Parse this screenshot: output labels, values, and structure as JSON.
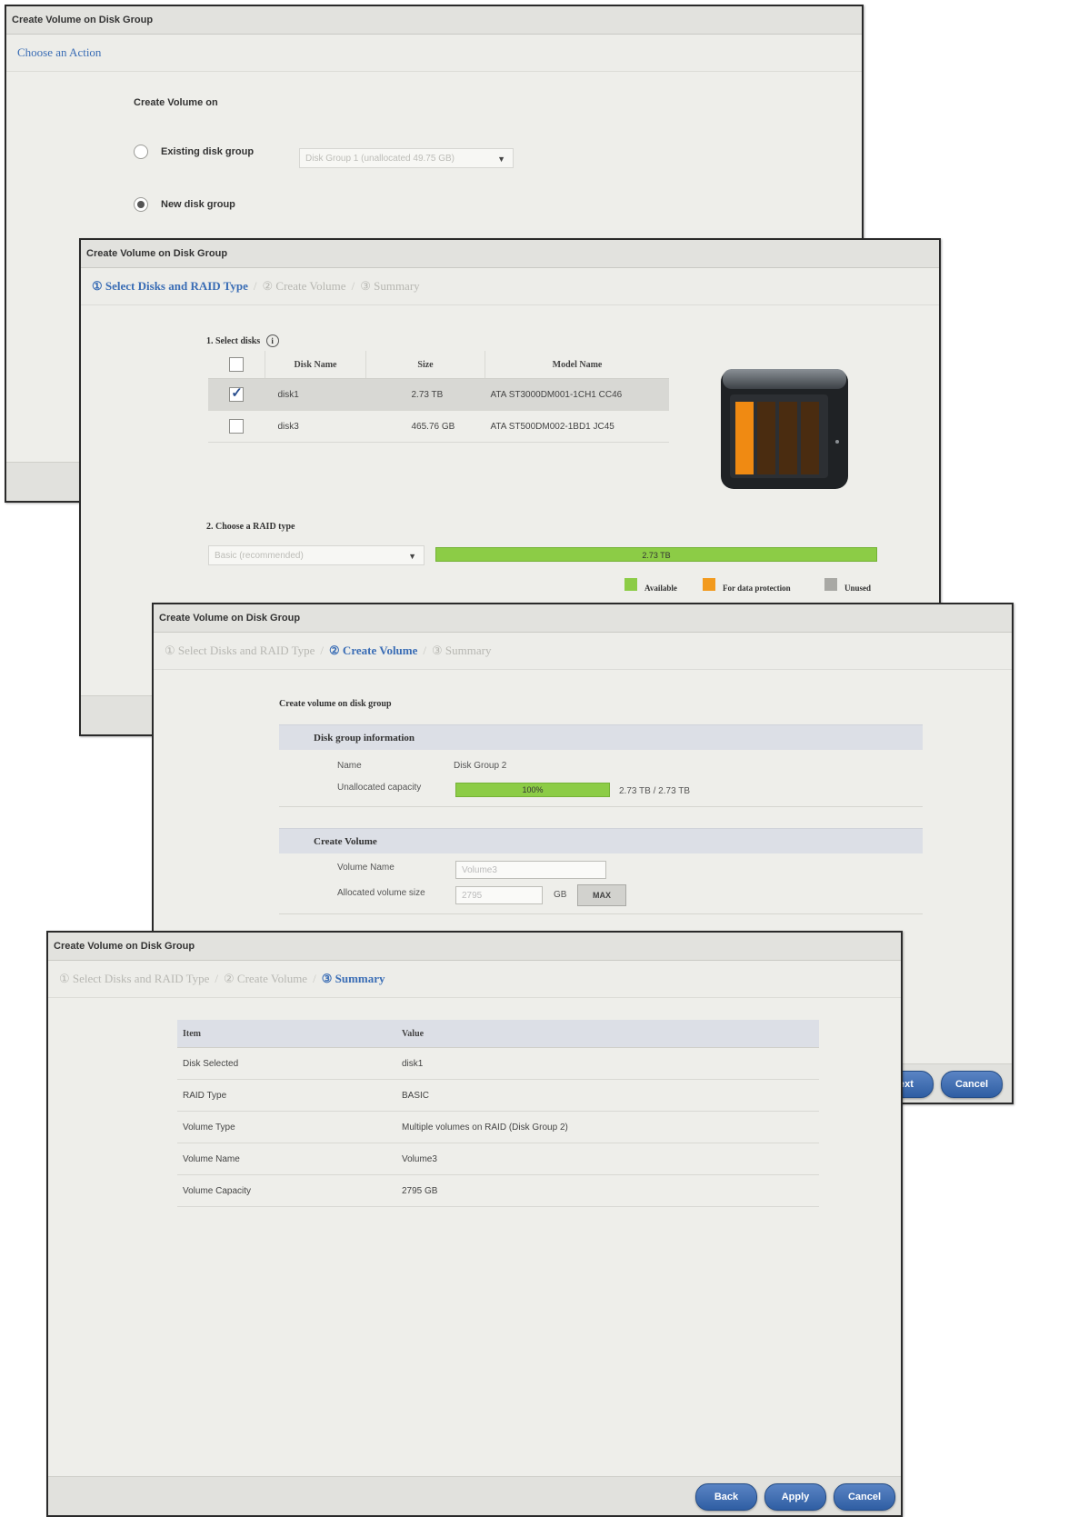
{
  "colors": {
    "accent": "#3a6db5",
    "available": "#8ccc46",
    "protection": "#f29a1e",
    "unused": "#a8a8a4"
  },
  "win1": {
    "title": "Create Volume on Disk Group",
    "step": "Choose an Action",
    "heading": "Create Volume on",
    "opt_existing": "Existing disk group",
    "existing_select": "Disk Group 1 (unallocated 49.75 GB)",
    "opt_new": "New disk group"
  },
  "win2": {
    "title": "Create Volume on Disk Group",
    "steps": [
      "① Select Disks and RAID Type",
      "② Create Volume",
      "③ Summary"
    ],
    "select_disks": "1. Select disks",
    "info_icon": "info-icon",
    "columns": [
      "Disk Name",
      "Size",
      "Model Name"
    ],
    "rows": [
      {
        "name": "disk1",
        "size": "2.73 TB",
        "model": "ATA ST3000DM001-1CH1 CC46",
        "checked": true
      },
      {
        "name": "disk3",
        "size": "465.76 GB",
        "model": "ATA ST500DM002-1BD1 JC45",
        "checked": false
      }
    ],
    "raid_label": "2. Choose a RAID type",
    "raid_select": "Basic (recommended)",
    "capacity_bar": "2.73 TB",
    "legend": [
      "Available",
      "For data protection",
      "Unused"
    ]
  },
  "win3": {
    "title": "Create Volume on Disk Group",
    "steps": [
      "① Select Disks and RAID Type",
      "② Create Volume",
      "③ Summary"
    ],
    "heading": "Create volume on disk group",
    "dg_info": "Disk group information",
    "name_label": "Name",
    "name_value": "Disk Group 2",
    "unalloc_label": "Unallocated capacity",
    "unalloc_bar": "100%",
    "unalloc_value": "2.73 TB / 2.73 TB",
    "create_volume": "Create Volume",
    "vol_name_label": "Volume Name",
    "vol_name_value": "Volume3",
    "alloc_label": "Allocated volume size",
    "alloc_value": "2795",
    "alloc_unit": "GB",
    "max": "MAX",
    "next": "Next",
    "cancel": "Cancel"
  },
  "win4": {
    "title": "Create Volume on Disk Group",
    "steps": [
      "① Select Disks and RAID Type",
      "② Create Volume",
      "③ Summary"
    ],
    "columns": [
      "Item",
      "Value"
    ],
    "rows": [
      [
        "Disk Selected",
        "disk1"
      ],
      [
        "RAID Type",
        "BASIC"
      ],
      [
        "Volume Type",
        "Multiple volumes on RAID (Disk Group 2)"
      ],
      [
        "Volume Name",
        "Volume3"
      ],
      [
        "Volume Capacity",
        "2795 GB"
      ]
    ],
    "back": "Back",
    "apply": "Apply",
    "cancel": "Cancel"
  }
}
